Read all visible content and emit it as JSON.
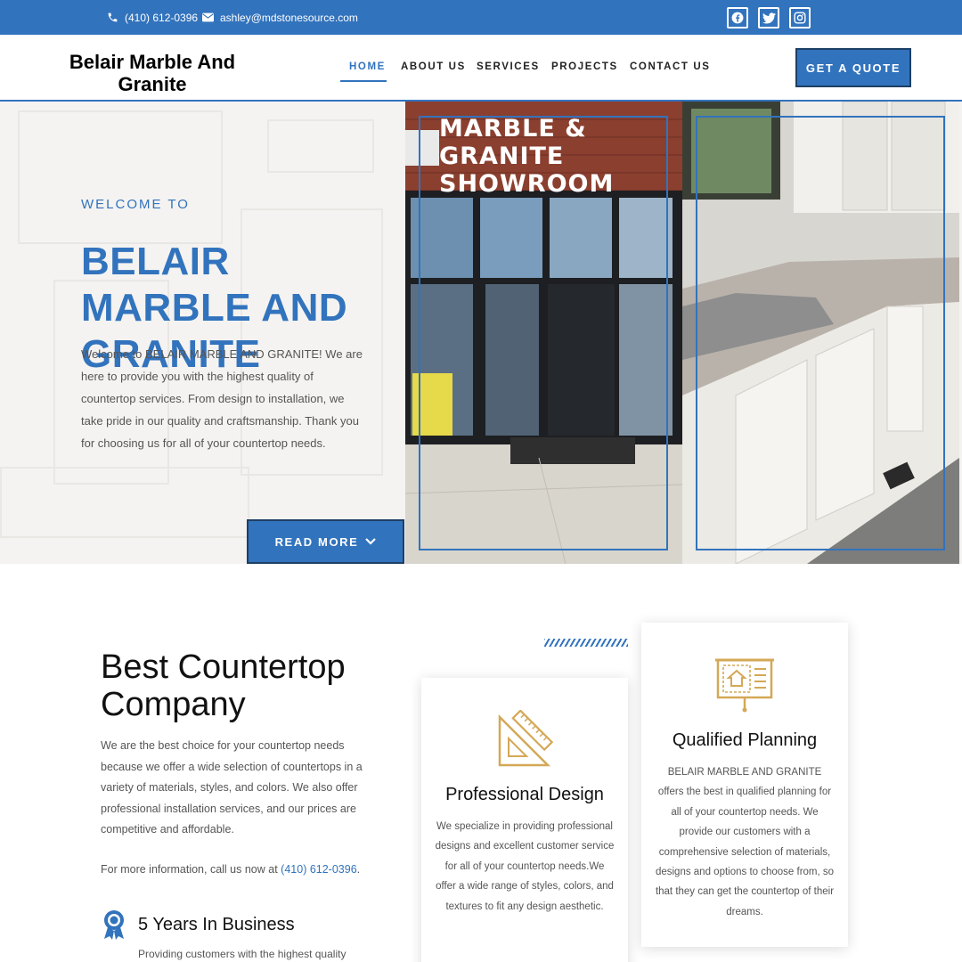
{
  "topbar": {
    "phone": "(410) 612-0396",
    "email": "ashley@mdstonesource.com",
    "social": [
      "facebook-icon",
      "twitter-icon",
      "instagram-icon"
    ],
    "color": "#3273bd"
  },
  "header": {
    "logo": "Belair Marble And Granite",
    "nav": [
      "HOME",
      "ABOUT US",
      "SERVICES",
      "PROJECTS",
      "CONTACT US"
    ],
    "active_nav": "HOME",
    "cta": "GET A QUOTE"
  },
  "hero": {
    "eyebrow": "WELCOME TO",
    "title": "BELAIR MARBLE AND GRANITE",
    "text": "Welcome to BELAIR MARBLE AND GRANITE! We are here to provide you with the highest quality of countertop services. From design to installation, we take pride in our quality and craftsmanship. Thank you for choosing us for all of your countertop needs.",
    "button": "READ MORE",
    "showroom_sign_line1": "MARBLE & GRANITE",
    "showroom_sign_line2": "SHOWROOM"
  },
  "about": {
    "title": "Best Countertop Company",
    "text": "We are the best choice for your countertop needs because we offer a wide selection of countertops in a variety of materials, styles, and colors. We also offer professional installation services, and our prices are competitive and affordable.",
    "call_prefix": "For more information, call us now at ",
    "call_phone": "(410) 612-0396",
    "call_suffix": ".",
    "feature_title": "5 Years In Business",
    "feature_text": "Providing customers with the highest quality"
  },
  "cards": {
    "design": {
      "title": "Professional Design",
      "text": "We specialize in providing professional designs and excellent customer service for all of your countertop needs.We offer a wide range of styles, colors, and textures to fit any design aesthetic."
    },
    "planning": {
      "title": "Qualified Planning",
      "text": "BELAIR MARBLE AND GRANITE offers the best in qualified planning for all of your countertop needs. We provide our customers with a comprehensive selection of materials, designs and options to choose from, so that they can get the countertop of their dreams."
    }
  }
}
